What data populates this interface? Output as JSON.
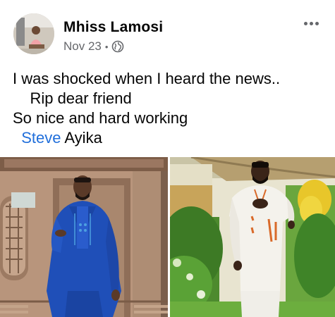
{
  "post": {
    "author": "Mhiss Lamosi",
    "date": "Nov 23",
    "separator": "•",
    "privacy_icon": "globe-icon",
    "more_icon": "more-options-icon",
    "text_lines": [
      "I was shocked when I heard the news..",
      "    Rip dear friend",
      "So nice and hard working"
    ],
    "mention_prefix": "  ",
    "mention_first": "Steve",
    "mention_last": " Ayika"
  },
  "colors": {
    "link": "#216fdb",
    "secondary_text": "#65676b",
    "primary_text": "#050505"
  },
  "photos": [
    {
      "name": "photo-man-in-blue-agbada",
      "description_icon": "photo"
    },
    {
      "name": "photo-man-in-white-outfit",
      "description_icon": "photo"
    }
  ]
}
